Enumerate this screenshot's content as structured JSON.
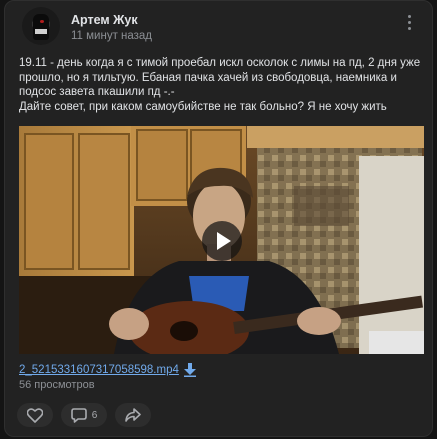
{
  "post": {
    "author": "Артем Жук",
    "time": "11 минут назад",
    "text": "19.11 - день когда я с тимой проебал искл осколок с лимы на пд, 2 дня уже прошло, но я тильтую. Ебаная пачка хачей из свободовца, наемника и подсос завета пкашили пд -.-\nДайте совет, при каком самоубийстве не так больно? Я не хочу жить",
    "video": {
      "filename": "2_5215331607317058598.mp4",
      "views": "56 просмотров"
    },
    "actions": {
      "comments_count": "6"
    }
  },
  "colors": {
    "card_bg": "#222222",
    "page_bg": "#141414",
    "link": "#71aaeb",
    "text": "#e1e3e6",
    "secondary": "#8c8f94"
  },
  "icons": [
    "more-icon",
    "play-icon",
    "download-icon",
    "heart-icon",
    "comment-icon",
    "share-icon"
  ]
}
